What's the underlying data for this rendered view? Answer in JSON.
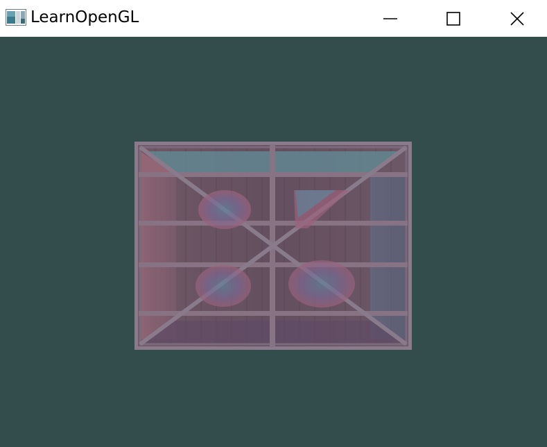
{
  "window": {
    "title": "LearnOpenGL",
    "clear_color": "#334c4c"
  },
  "titlebar": {
    "background": "#ffffff",
    "icon": "opengl-app-icon",
    "controls": {
      "minimize_icon": "minimize-icon",
      "maximize_icon": "maximize-icon",
      "close_icon": "close-icon"
    }
  },
  "scene": {
    "object": "textured-quad",
    "textures": [
      "wooden-container",
      "awesomeface"
    ],
    "texture_wood_color": "#6e5560",
    "texture_tint_color": "#7a6a82"
  }
}
